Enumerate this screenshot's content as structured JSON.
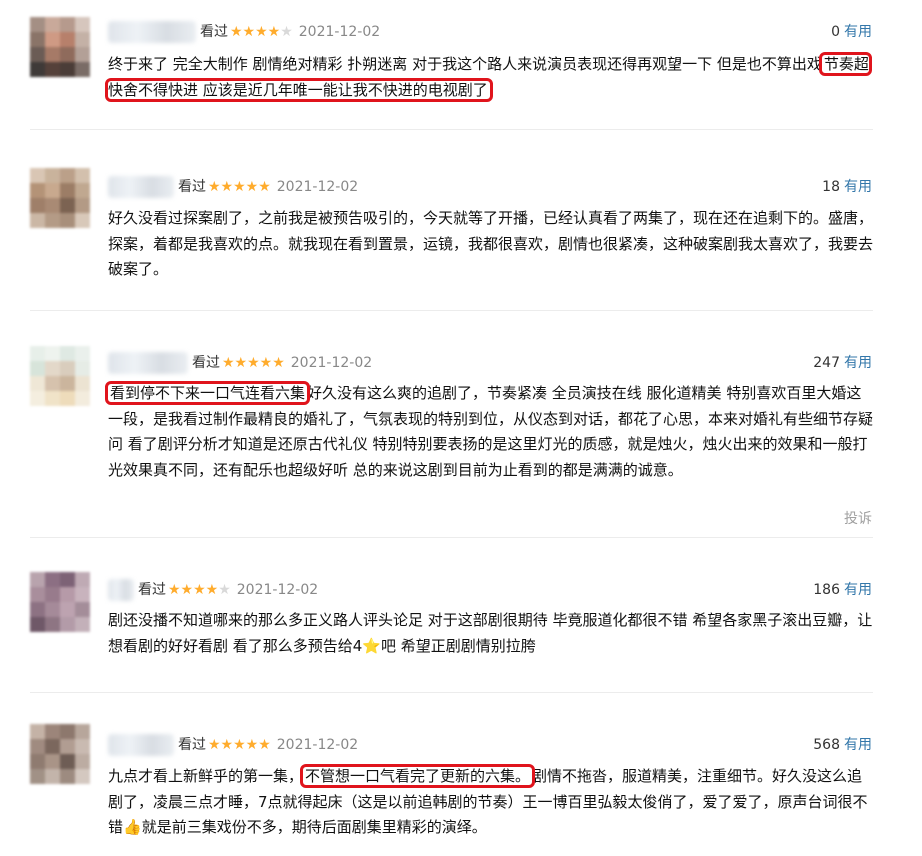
{
  "reviews": [
    {
      "seen": "看过",
      "stars": 4,
      "date": "2021-12-02",
      "useful_count": "0",
      "useful_label": "有用",
      "text_before": "终于来了 完全大制作 剧情绝对精彩 扑朔迷离 对于我这个路人来说演员表现还得再观望一下 但是也不算出戏",
      "highlight": "节奏超快舍不得快进 应该是近几年唯一能让我不快进的电视剧了",
      "text_after": ""
    },
    {
      "seen": "看过",
      "stars": 5,
      "date": "2021-12-02",
      "useful_count": "18",
      "useful_label": "有用",
      "text_before": "好久没看过探案剧了，之前我是被预告吸引的，今天就等了开播，已经认真看了两集了，现在还在追剩下的。盛唐，探案，着都是我喜欢的点。就我现在看到置景，运镜，我都很喜欢，剧情也很紧凑，这种破案剧我太喜欢了，我要去破案了。",
      "highlight": "",
      "text_after": ""
    },
    {
      "seen": "看过",
      "stars": 5,
      "date": "2021-12-02",
      "useful_count": "247",
      "useful_label": "有用",
      "text_before": "",
      "highlight": "看到停不下来一口气连看六集",
      "text_after": "好久没有这么爽的追剧了，节奏紧凑 全员演技在线 服化道精美 特别喜欢百里大婚这一段，是我看过制作最精良的婚礼了，气氛表现的特别到位，从仪态到对话，都花了心思，本来对婚礼有些细节存疑问 看了剧评分析才知道是还原古代礼仪 特别特别要表扬的是这里灯光的质感，就是烛火，烛火出来的效果和一般打光效果真不同，还有配乐也超级好听 总的来说这剧到目前为止看到的都是满满的诚意。",
      "report": "投诉"
    },
    {
      "seen": "看过",
      "stars": 4,
      "date": "2021-12-02",
      "useful_count": "186",
      "useful_label": "有用",
      "text_before": "剧还没播不知道哪来的那么多正义路人评头论足 对于这部剧很期待 毕竟服道化都很不错 希望各家黑子滚出豆瓣，让想看剧的好好看剧 看了那么多预告给4",
      "emoji": "⭐",
      "text_after": "吧 希望正剧剧情别拉胯",
      "highlight": ""
    },
    {
      "seen": "看过",
      "stars": 5,
      "date": "2021-12-02",
      "useful_count": "568",
      "useful_label": "有用",
      "text_before": "九点才看上新鲜乎的第一集，",
      "highlight": "不管想一口气看完了更新的六集。",
      "text_mid": "剧情不拖沓，服道精美，注重细节。好久没这么追剧了，凌晨三点才睡，7点就得起床（这是以前追韩剧的节奏）王一博百里弘毅太俊俏了，爱了爱了，原声台词很不错",
      "emoji": "👍",
      "text_after": "就是前三集戏份不多，期待后面剧集里精彩的演绎。"
    }
  ],
  "colors": {
    "star": "#ffac2d",
    "useful": "#3377aa",
    "highlight_box": "#e0141c"
  },
  "icons": {
    "star": "star-icon"
  }
}
